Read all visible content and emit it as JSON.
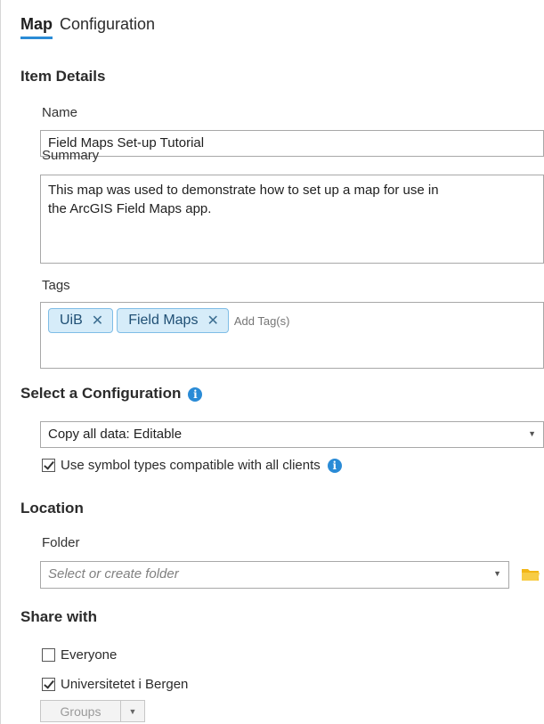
{
  "tabs": [
    {
      "label": "Map",
      "active": true
    },
    {
      "label": "Configuration",
      "active": false
    }
  ],
  "item_details": {
    "title": "Item Details",
    "name_label": "Name",
    "name_value": "Field Maps Set-up Tutorial",
    "summary_label": "Summary",
    "summary_value": "This map was used to demonstrate how to set up a map for use in\nthe ArcGIS Field Maps app.",
    "tags_label": "Tags",
    "tags": [
      "UiB",
      "Field Maps"
    ],
    "tag_remove_glyph": "✕",
    "add_tag_placeholder": "Add Tag(s)"
  },
  "configuration": {
    "title": "Select a Configuration",
    "selected_value": "Copy all data: Editable",
    "symbol_checkbox_label": "Use symbol types compatible with all clients",
    "symbol_checkbox_checked": true
  },
  "location": {
    "title": "Location",
    "folder_label": "Folder",
    "folder_placeholder": "Select or create folder"
  },
  "share": {
    "title": "Share with",
    "everyone_label": "Everyone",
    "everyone_checked": false,
    "org_label": "Universitetet i Bergen",
    "org_checked": true,
    "groups_label": "Groups"
  },
  "colors": {
    "accent": "#2a8bd6",
    "tag_bg": "#d6ecf9",
    "tag_border": "#7fbde6",
    "folder_icon": "#f2b616"
  },
  "icons": {
    "info": "info-icon",
    "folder": "folder-icon",
    "dropdown": "chevron-down-icon",
    "tag_remove": "close-icon",
    "check": "checkmark-icon"
  }
}
